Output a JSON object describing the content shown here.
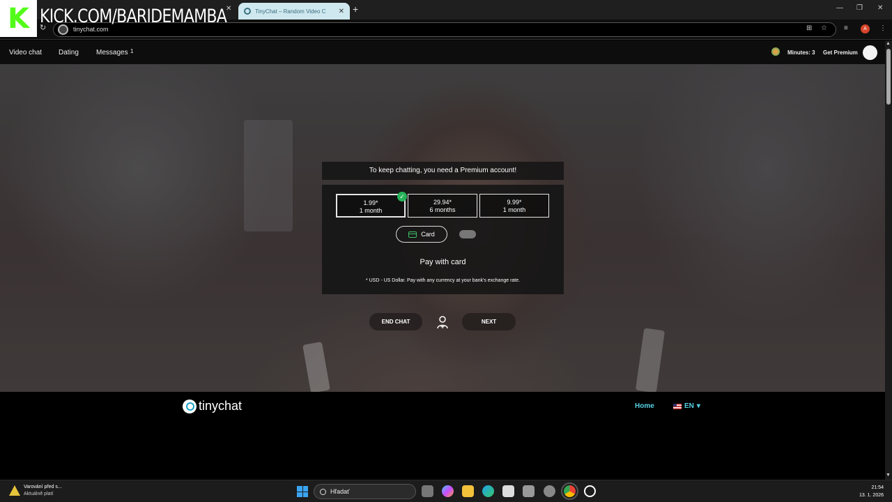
{
  "browser": {
    "active_tab_title": "TinyChat – Random Video C",
    "tab_close": "✕",
    "new_tab": "+",
    "url": "tinychat.com",
    "profile_initial": "A",
    "window_controls": [
      "—",
      "❐",
      "✕"
    ]
  },
  "overlay": {
    "logo_letter": "K",
    "stream_url": "KICK.COM/BARIDEMAMBA"
  },
  "nav": {
    "video_chat": "Video chat",
    "dating": "Dating",
    "messages": "Messages",
    "messages_badge": "1",
    "minutes": "Minutes: 3",
    "get_premium": "Get Premium"
  },
  "premium": {
    "banner": "To keep chatting, you need a Premium account!",
    "plans": [
      {
        "price": "1.99*",
        "period": "1 month",
        "selected": true
      },
      {
        "price": "29.94*",
        "period": "6 months",
        "selected": false
      },
      {
        "price": "9.99*",
        "period": "1 month",
        "selected": false
      }
    ],
    "card_label": "Card",
    "pay_title": "Pay with card",
    "note": "* USD - US Dollar. Pay with any currency at your bank's exchange rate."
  },
  "controls": {
    "end_chat": "END CHAT",
    "next": "NEXT"
  },
  "footer": {
    "logo_text": "tinychat",
    "home": "Home",
    "language": "EN"
  },
  "taskbar": {
    "warning_title": "Varování před s...",
    "warning_sub": "Aktuálně platí",
    "search_placeholder": "Hľadať",
    "time": "21:54",
    "date": "13. 1. 2026"
  },
  "colors": {
    "kick_green": "#53fc18",
    "tinychat_accent": "#56d1e4",
    "check_green": "#27b35a"
  }
}
